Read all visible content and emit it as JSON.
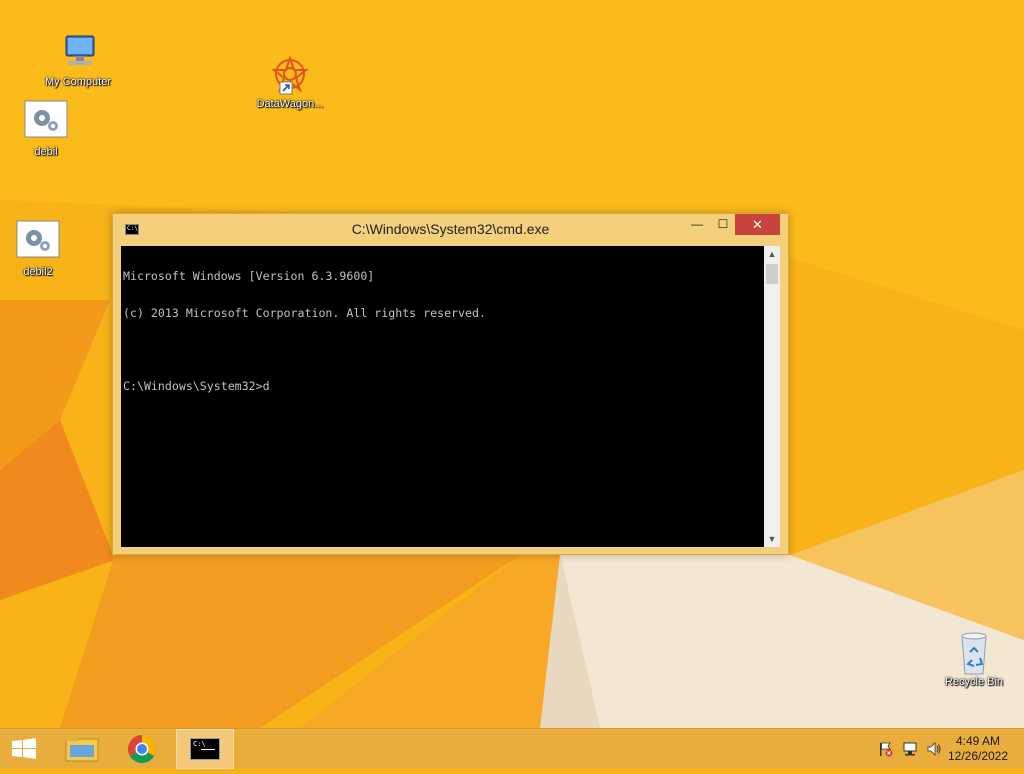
{
  "desktop": {
    "icons": [
      {
        "label": "My Computer",
        "icon": "computer-icon"
      },
      {
        "label": "DataWagon...",
        "icon": "datawagon-shortcut-icon"
      },
      {
        "label": "debil",
        "icon": "settings-file-icon"
      },
      {
        "label": "debil2",
        "icon": "settings-file-icon"
      },
      {
        "label": "Recycle Bin",
        "icon": "recycle-bin-icon"
      }
    ]
  },
  "cmd_window": {
    "title": "C:\\Windows\\System32\\cmd.exe",
    "titlebar_icon_text": "C:\\",
    "minimize_glyph": "—",
    "maximize_glyph": "☐",
    "close_glyph": "✕",
    "lines": [
      "Microsoft Windows [Version 6.3.9600]",
      "(c) 2013 Microsoft Corporation. All rights reserved.",
      "",
      "C:\\Windows\\System32>d"
    ]
  },
  "taskbar": {
    "cmd_button_text": "C:\\",
    "clock_time": "4:49 AM",
    "clock_date": "12/26/2022"
  },
  "colors": {
    "desktop_bg": "#f6b21a",
    "window_frame": "#f4cf7c",
    "close_button": "#c7443d",
    "console_bg": "#000000",
    "console_fg": "#c0c0c0",
    "taskbar": "#e9ad3e"
  }
}
